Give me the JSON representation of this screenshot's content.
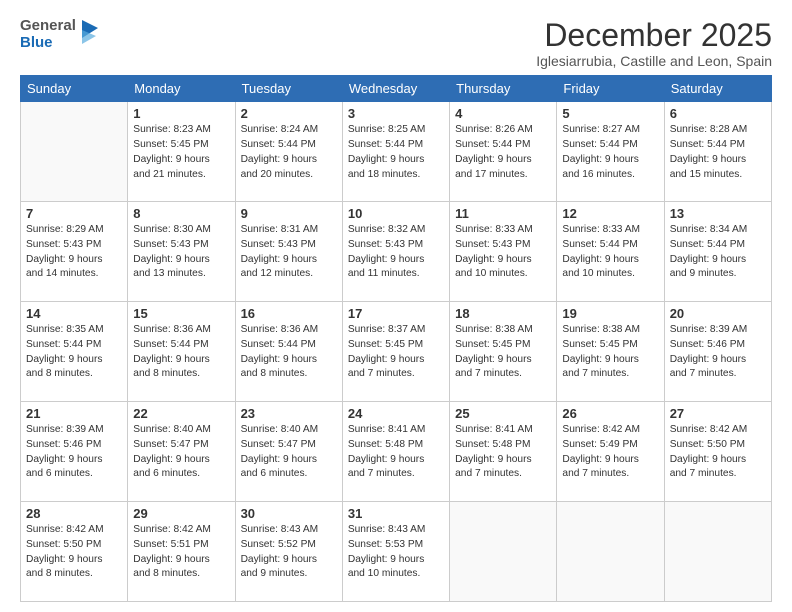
{
  "logo": {
    "general": "General",
    "blue": "Blue"
  },
  "header": {
    "month_year": "December 2025",
    "location": "Iglesiarrubia, Castille and Leon, Spain"
  },
  "weekdays": [
    "Sunday",
    "Monday",
    "Tuesday",
    "Wednesday",
    "Thursday",
    "Friday",
    "Saturday"
  ],
  "weeks": [
    [
      {
        "day": "",
        "info": ""
      },
      {
        "day": "1",
        "info": "Sunrise: 8:23 AM\nSunset: 5:45 PM\nDaylight: 9 hours\nand 21 minutes."
      },
      {
        "day": "2",
        "info": "Sunrise: 8:24 AM\nSunset: 5:44 PM\nDaylight: 9 hours\nand 20 minutes."
      },
      {
        "day": "3",
        "info": "Sunrise: 8:25 AM\nSunset: 5:44 PM\nDaylight: 9 hours\nand 18 minutes."
      },
      {
        "day": "4",
        "info": "Sunrise: 8:26 AM\nSunset: 5:44 PM\nDaylight: 9 hours\nand 17 minutes."
      },
      {
        "day": "5",
        "info": "Sunrise: 8:27 AM\nSunset: 5:44 PM\nDaylight: 9 hours\nand 16 minutes."
      },
      {
        "day": "6",
        "info": "Sunrise: 8:28 AM\nSunset: 5:44 PM\nDaylight: 9 hours\nand 15 minutes."
      }
    ],
    [
      {
        "day": "7",
        "info": "Sunrise: 8:29 AM\nSunset: 5:43 PM\nDaylight: 9 hours\nand 14 minutes."
      },
      {
        "day": "8",
        "info": "Sunrise: 8:30 AM\nSunset: 5:43 PM\nDaylight: 9 hours\nand 13 minutes."
      },
      {
        "day": "9",
        "info": "Sunrise: 8:31 AM\nSunset: 5:43 PM\nDaylight: 9 hours\nand 12 minutes."
      },
      {
        "day": "10",
        "info": "Sunrise: 8:32 AM\nSunset: 5:43 PM\nDaylight: 9 hours\nand 11 minutes."
      },
      {
        "day": "11",
        "info": "Sunrise: 8:33 AM\nSunset: 5:43 PM\nDaylight: 9 hours\nand 10 minutes."
      },
      {
        "day": "12",
        "info": "Sunrise: 8:33 AM\nSunset: 5:44 PM\nDaylight: 9 hours\nand 10 minutes."
      },
      {
        "day": "13",
        "info": "Sunrise: 8:34 AM\nSunset: 5:44 PM\nDaylight: 9 hours\nand 9 minutes."
      }
    ],
    [
      {
        "day": "14",
        "info": "Sunrise: 8:35 AM\nSunset: 5:44 PM\nDaylight: 9 hours\nand 8 minutes."
      },
      {
        "day": "15",
        "info": "Sunrise: 8:36 AM\nSunset: 5:44 PM\nDaylight: 9 hours\nand 8 minutes."
      },
      {
        "day": "16",
        "info": "Sunrise: 8:36 AM\nSunset: 5:44 PM\nDaylight: 9 hours\nand 8 minutes."
      },
      {
        "day": "17",
        "info": "Sunrise: 8:37 AM\nSunset: 5:45 PM\nDaylight: 9 hours\nand 7 minutes."
      },
      {
        "day": "18",
        "info": "Sunrise: 8:38 AM\nSunset: 5:45 PM\nDaylight: 9 hours\nand 7 minutes."
      },
      {
        "day": "19",
        "info": "Sunrise: 8:38 AM\nSunset: 5:45 PM\nDaylight: 9 hours\nand 7 minutes."
      },
      {
        "day": "20",
        "info": "Sunrise: 8:39 AM\nSunset: 5:46 PM\nDaylight: 9 hours\nand 7 minutes."
      }
    ],
    [
      {
        "day": "21",
        "info": "Sunrise: 8:39 AM\nSunset: 5:46 PM\nDaylight: 9 hours\nand 6 minutes."
      },
      {
        "day": "22",
        "info": "Sunrise: 8:40 AM\nSunset: 5:47 PM\nDaylight: 9 hours\nand 6 minutes."
      },
      {
        "day": "23",
        "info": "Sunrise: 8:40 AM\nSunset: 5:47 PM\nDaylight: 9 hours\nand 6 minutes."
      },
      {
        "day": "24",
        "info": "Sunrise: 8:41 AM\nSunset: 5:48 PM\nDaylight: 9 hours\nand 7 minutes."
      },
      {
        "day": "25",
        "info": "Sunrise: 8:41 AM\nSunset: 5:48 PM\nDaylight: 9 hours\nand 7 minutes."
      },
      {
        "day": "26",
        "info": "Sunrise: 8:42 AM\nSunset: 5:49 PM\nDaylight: 9 hours\nand 7 minutes."
      },
      {
        "day": "27",
        "info": "Sunrise: 8:42 AM\nSunset: 5:50 PM\nDaylight: 9 hours\nand 7 minutes."
      }
    ],
    [
      {
        "day": "28",
        "info": "Sunrise: 8:42 AM\nSunset: 5:50 PM\nDaylight: 9 hours\nand 8 minutes."
      },
      {
        "day": "29",
        "info": "Sunrise: 8:42 AM\nSunset: 5:51 PM\nDaylight: 9 hours\nand 8 minutes."
      },
      {
        "day": "30",
        "info": "Sunrise: 8:43 AM\nSunset: 5:52 PM\nDaylight: 9 hours\nand 9 minutes."
      },
      {
        "day": "31",
        "info": "Sunrise: 8:43 AM\nSunset: 5:53 PM\nDaylight: 9 hours\nand 10 minutes."
      },
      {
        "day": "",
        "info": ""
      },
      {
        "day": "",
        "info": ""
      },
      {
        "day": "",
        "info": ""
      }
    ]
  ]
}
